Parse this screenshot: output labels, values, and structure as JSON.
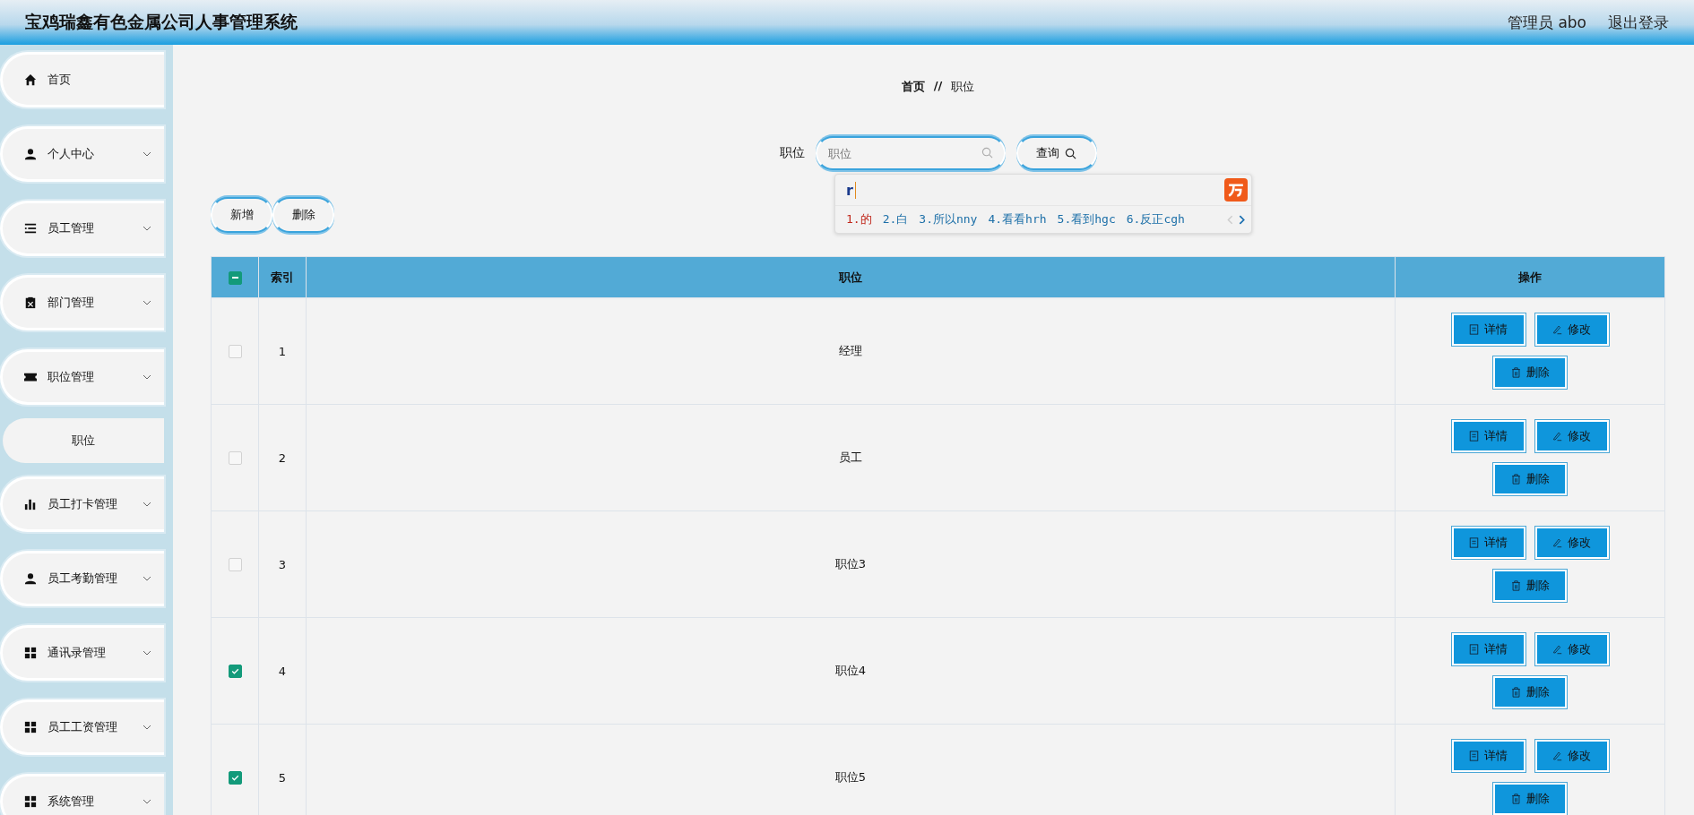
{
  "header": {
    "title": "宝鸡瑞鑫有色金属公司人事管理系统",
    "user": "管理员 abo",
    "logout": "退出登录"
  },
  "sidebar": {
    "items": [
      {
        "label": "首页",
        "kind": "link",
        "selected": false
      },
      {
        "label": "个人中心",
        "kind": "group",
        "selected": false
      },
      {
        "label": "员工管理",
        "kind": "group",
        "selected": false
      },
      {
        "label": "部门管理",
        "kind": "group",
        "selected": false
      },
      {
        "label": "职位管理",
        "kind": "group",
        "selected": false
      },
      {
        "label": "职位",
        "kind": "sub",
        "selected": true
      },
      {
        "label": "员工打卡管理",
        "kind": "group",
        "selected": false
      },
      {
        "label": "员工考勤管理",
        "kind": "group",
        "selected": false
      },
      {
        "label": "通讯录管理",
        "kind": "group",
        "selected": false
      },
      {
        "label": "员工工资管理",
        "kind": "group",
        "selected": false
      },
      {
        "label": "系统管理",
        "kind": "group",
        "selected": false
      }
    ]
  },
  "breadcrumb": [
    "首页",
    "职位"
  ],
  "breadcrumb_separator": "//",
  "search": {
    "label": "职位",
    "placeholder": "职位",
    "button": "查询"
  },
  "ime": {
    "input": "r",
    "candidates": [
      {
        "text": "1.的",
        "selected": true
      },
      {
        "text": "2.白",
        "selected": false
      },
      {
        "text": "3.所以nny",
        "selected": false
      },
      {
        "text": "4.看看hrh",
        "selected": false
      },
      {
        "text": "5.看到hgc",
        "selected": false
      },
      {
        "text": "6.反正cgh",
        "selected": false
      }
    ]
  },
  "actions": [
    "新增",
    "删除"
  ],
  "table": {
    "select_all": {
      "indeterminate": true
    },
    "columns": [
      "索引",
      "职位",
      "操作"
    ],
    "rows": [
      {
        "checked": false,
        "index": "1",
        "position": "经理",
        "buttons": [
          "详情",
          "修改",
          "删除"
        ]
      },
      {
        "checked": false,
        "index": "2",
        "position": "员工",
        "buttons": [
          "详情",
          "修改",
          "删除"
        ]
      },
      {
        "checked": false,
        "index": "3",
        "position": "职位3",
        "buttons": [
          "详情",
          "修改",
          "删除"
        ]
      },
      {
        "checked": true,
        "index": "4",
        "position": "职位4",
        "buttons": [
          "详情",
          "修改",
          "删除"
        ]
      },
      {
        "checked": true,
        "index": "5",
        "position": "职位5",
        "buttons": [
          "详情",
          "修改",
          "删除"
        ]
      }
    ]
  }
}
